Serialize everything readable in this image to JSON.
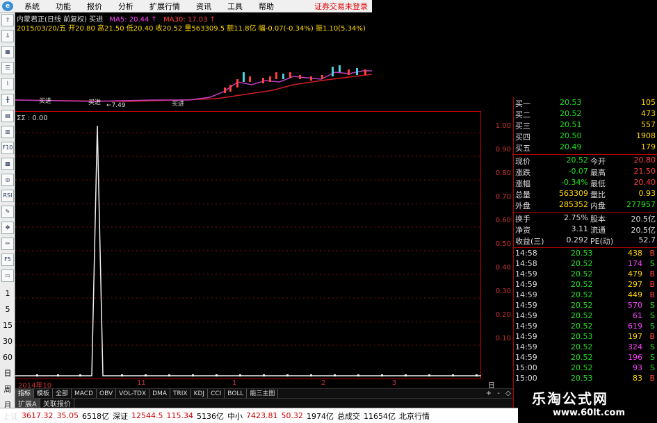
{
  "menu": {
    "items": [
      "系统",
      "功能",
      "报价",
      "分析",
      "扩展行情",
      "资讯",
      "工具",
      "帮助"
    ],
    "login_text": "证券交易未登录"
  },
  "toolbar": {
    "periods": [
      "1",
      "5",
      "15",
      "30",
      "60",
      "日",
      "周",
      "月"
    ]
  },
  "kline": {
    "header1": "内蒙君正(日线 前复权) 买进",
    "ma5": "MA5: 20.44 ↑",
    "ma30": "MA30: 17.03 ↑",
    "header2": "2015/03/20/五 开20.80 高21.50 低20.40 收20.52 量563309.5 额11.8亿 幅-0.07(-0.34%) 振1.10(5.34%)",
    "signals": [
      "买进",
      "买进",
      "买进"
    ],
    "low_label": "←7.49"
  },
  "indicator": {
    "title": "ΣΣ : 0.00",
    "ticks": [
      "1.00",
      "0.90",
      "0.80",
      "0.70",
      "0.60",
      "0.50",
      "0.40",
      "0.30",
      "0.20",
      "0.10"
    ],
    "dates": [
      "2014年10",
      "11",
      "1",
      "2",
      "3"
    ],
    "period_label": "日线"
  },
  "tabs": {
    "row1": [
      "指标",
      "模板",
      "全部",
      "MACD",
      "OBV",
      "VOL-TDX",
      "DMA",
      "TRIX",
      "KDJ",
      "CCI",
      "BOLL",
      "能三主图"
    ],
    "row2": [
      "扩展A",
      "关联报价"
    ],
    "controls": [
      "+",
      "-",
      "◇"
    ]
  },
  "quote": {
    "bids": [
      {
        "label": "买一",
        "price": "20.53",
        "vol": "105"
      },
      {
        "label": "买二",
        "price": "20.52",
        "vol": "473"
      },
      {
        "label": "买三",
        "price": "20.51",
        "vol": "557"
      },
      {
        "label": "买四",
        "price": "20.50",
        "vol": "1908"
      },
      {
        "label": "买五",
        "price": "20.49",
        "vol": "179"
      }
    ],
    "stats": [
      {
        "l1": "现价",
        "v1": "20.52",
        "l2": "今开",
        "v2": "20.80"
      },
      {
        "l1": "涨跌",
        "v1": "-0.07",
        "l2": "最高",
        "v2": "21.50"
      },
      {
        "l1": "涨幅",
        "v1": "-0.34%",
        "l2": "最低",
        "v2": "20.40"
      },
      {
        "l1": "总量",
        "v1": "563309",
        "l2": "量比",
        "v2": "0.93"
      },
      {
        "l1": "外盘",
        "v1": "285352",
        "l2": "内盘",
        "v2": "277957"
      }
    ],
    "finance": [
      {
        "l1": "换手",
        "v1": "2.75%",
        "l2": "股本",
        "v2": "20.5亿"
      },
      {
        "l1": "净资",
        "v1": "3.11",
        "l2": "流通",
        "v2": "20.5亿"
      },
      {
        "l1": "收益(三)",
        "v1": "0.292",
        "l2": "PE(动)",
        "v2": "52.7"
      }
    ],
    "trades": [
      {
        "t": "14:58",
        "p": "20.53",
        "v": "438",
        "s": "B"
      },
      {
        "t": "14:58",
        "p": "20.52",
        "v": "174",
        "s": "S"
      },
      {
        "t": "14:59",
        "p": "20.52",
        "v": "479",
        "s": "B"
      },
      {
        "t": "14:59",
        "p": "20.52",
        "v": "297",
        "s": "B"
      },
      {
        "t": "14:59",
        "p": "20.52",
        "v": "449",
        "s": "B"
      },
      {
        "t": "14:59",
        "p": "20.52",
        "v": "570",
        "s": "S"
      },
      {
        "t": "14:59",
        "p": "20.52",
        "v": "61",
        "s": "S"
      },
      {
        "t": "14:59",
        "p": "20.52",
        "v": "619",
        "s": "S"
      },
      {
        "t": "14:59",
        "p": "20.53",
        "v": "197",
        "s": "B"
      },
      {
        "t": "14:59",
        "p": "20.52",
        "v": "324",
        "s": "S"
      },
      {
        "t": "14:59",
        "p": "20.52",
        "v": "196",
        "s": "S"
      },
      {
        "t": "15:00",
        "p": "20.52",
        "v": "93",
        "s": "S"
      },
      {
        "t": "15:00",
        "p": "20.53",
        "v": "83",
        "s": "B"
      }
    ]
  },
  "status": {
    "items": [
      {
        "label": "上证",
        "v1": "3617.32",
        "v2": "35.05",
        "v3": "6518亿"
      },
      {
        "label": "深证",
        "v1": "12544.5",
        "v2": "115.34",
        "v3": "5136亿"
      },
      {
        "label": "中小",
        "v1": "7423.81",
        "v2": "50.32",
        "v3": "1974亿"
      },
      {
        "label": "总成交",
        "v1": "11654亿",
        "v2": "北京行情",
        "v3": ""
      }
    ]
  },
  "watermark": {
    "title": "乐淘公式网",
    "url": "www.60lt.com"
  }
}
